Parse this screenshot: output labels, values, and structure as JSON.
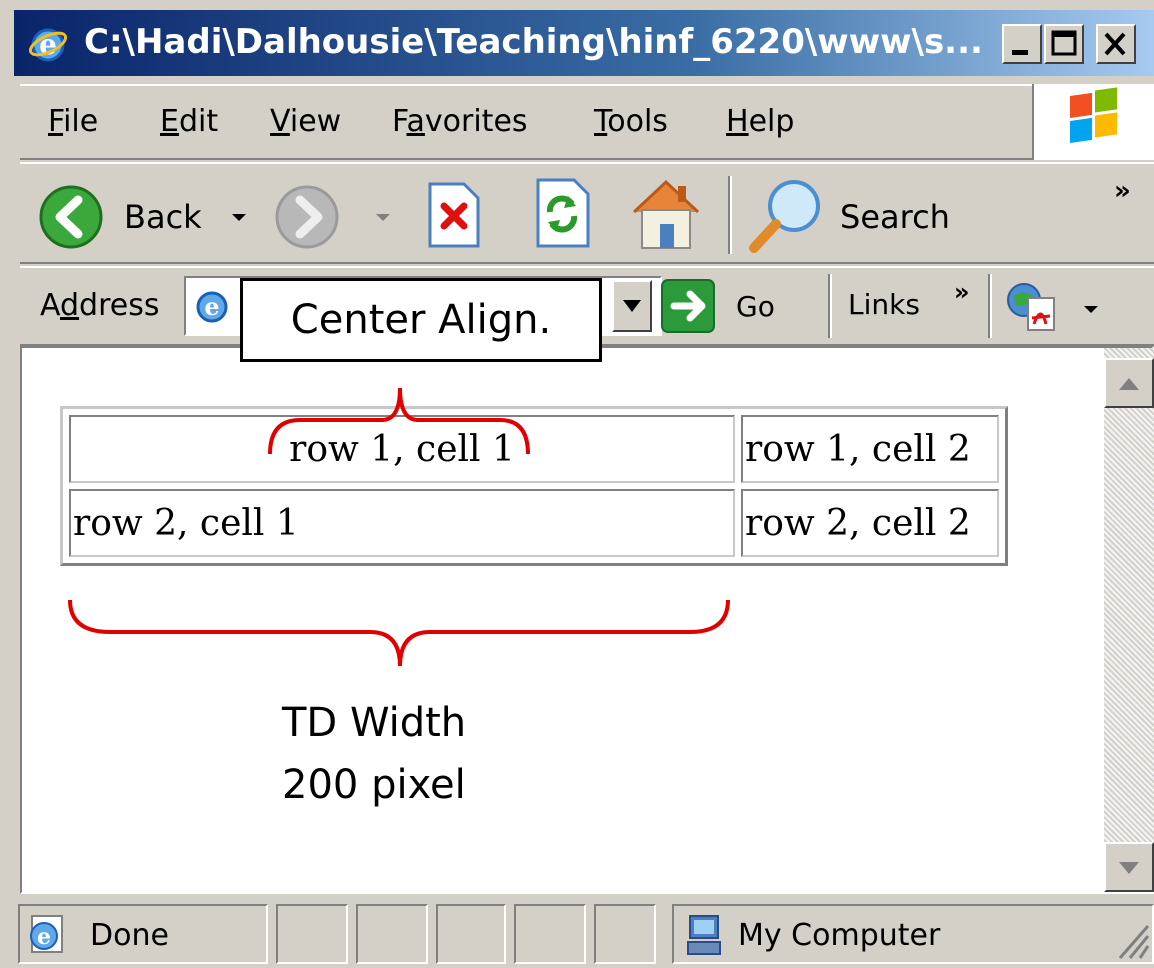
{
  "window": {
    "title": "C:\\Hadi\\Dalhousie\\Teaching\\hinf_6220\\www\\s..."
  },
  "menu": {
    "items": [
      {
        "pre": "",
        "key": "F",
        "post": "ile"
      },
      {
        "pre": "",
        "key": "E",
        "post": "dit"
      },
      {
        "pre": "",
        "key": "V",
        "post": "iew"
      },
      {
        "pre": "F",
        "key": "a",
        "post": "vorites"
      },
      {
        "pre": "",
        "key": "T",
        "post": "ools"
      },
      {
        "pre": "",
        "key": "H",
        "post": "elp"
      }
    ]
  },
  "toolbar": {
    "back_label": "Back",
    "search_label": "Search",
    "more": "»"
  },
  "address": {
    "label_pre": "A",
    "label_key": "d",
    "label_post": "dress",
    "go_label": "Go",
    "links_label": "Links",
    "links_more": "»"
  },
  "content": {
    "callout": "Center Align.",
    "table": [
      [
        "row 1, cell 1",
        "row 1, cell 2"
      ],
      [
        "row 2, cell 1",
        "row 2, cell 2"
      ]
    ],
    "annotation_line1": "TD Width",
    "annotation_line2": "200 pixel"
  },
  "status": {
    "text": "Done",
    "zone": "My Computer"
  },
  "colors": {
    "brace": "#e00000",
    "titlebar_start": "#0a246a",
    "titlebar_end": "#a6caf0"
  }
}
